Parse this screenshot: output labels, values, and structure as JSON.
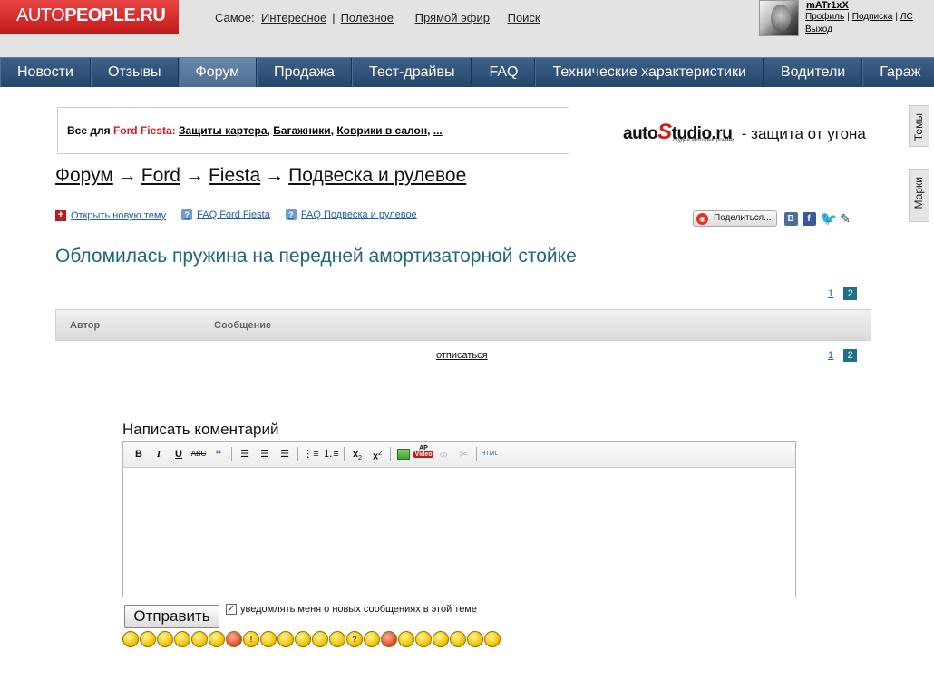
{
  "logo": {
    "part1": "AUTO",
    "part2": "PEOPLE.RU"
  },
  "topnav": {
    "prefix": "Самое:",
    "items": [
      "Интересное",
      "Полезное",
      "Прямой эфир",
      "Поиск"
    ]
  },
  "user": {
    "name": "mATr1xX",
    "links": [
      "Профиль",
      "Подписка",
      "ЛС"
    ],
    "logout": "Выход"
  },
  "mainnav": {
    "items": [
      "Новости",
      "Отзывы",
      "Форум",
      "Продажа",
      "Тест-драйвы",
      "FAQ",
      "Технические характеристики",
      "Водители",
      "Гараж"
    ],
    "active": "Форум"
  },
  "side_tabs": {
    "themes": "Темы",
    "brands": "Марки"
  },
  "ad": {
    "prefix": "Все для",
    "model": "Ford Fiesta:",
    "links": [
      "Защиты картера",
      "Багажники",
      "Коврики в салон",
      "..."
    ]
  },
  "autostudio": {
    "logo_a": "auto",
    "logo_s": "S",
    "logo_b": "tudio.ru",
    "sub": "студия автоэлектроники",
    "text": "- защита от угона"
  },
  "breadcrumb": {
    "items": [
      "Форум",
      "Ford",
      "Fiesta",
      "Подвеска и рулевое"
    ],
    "arrow": "→"
  },
  "actions": {
    "new_topic": "Открыть новую тему",
    "faq_model": "FAQ Ford Fiesta",
    "faq_section": "FAQ Подвеска и рулевое"
  },
  "share": {
    "label": "Поделиться...",
    "vk": "B",
    "fb": "f"
  },
  "topic_title": "Обломилась пружина на передней амортизаторной стойке",
  "pager": {
    "page1": "1",
    "page2": "2",
    "current": 2
  },
  "table": {
    "col_author": "Автор",
    "col_message": "Сообщение"
  },
  "unsubscribe": "отписаться",
  "comment": {
    "heading": "Написать коментарий",
    "send": "Отправить",
    "notify": "уведомлять меня о новых сообщениях в этой теме",
    "notify_checked": true
  },
  "toolbar_icons": [
    "bold-icon",
    "italic-icon",
    "underline-icon",
    "strikethrough-icon",
    "quote-icon",
    "align-left-icon",
    "align-center-icon",
    "align-right-icon",
    "bullet-list-icon",
    "numbered-list-icon",
    "subscript-icon",
    "superscript-icon",
    "image-icon",
    "video-icon",
    "link-icon",
    "unlink-icon",
    "html-icon"
  ],
  "smilies_count": 22
}
